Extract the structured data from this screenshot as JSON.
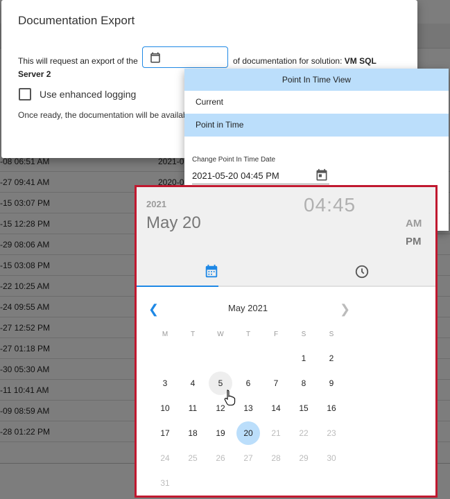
{
  "background": {
    "rows": [
      {
        "c1": "-08 06:51 AM",
        "c2": "2021-0"
      },
      {
        "c1": "-27 09:41 AM",
        "c2": "2020-0"
      },
      {
        "c1": "-15 03:07 PM",
        "c2": ""
      },
      {
        "c1": "-15 12:28 PM",
        "c2": ""
      },
      {
        "c1": "-29 08:06 AM",
        "c2": ""
      },
      {
        "c1": "-15 03:08 PM",
        "c2": ""
      },
      {
        "c1": "-22 10:25 AM",
        "c2": ""
      },
      {
        "c1": "-24 09:55 AM",
        "c2": ""
      },
      {
        "c1": "-27 12:52 PM",
        "c2": ""
      },
      {
        "c1": "-27 01:18 PM",
        "c2": ""
      },
      {
        "c1": "-30 05:30 AM",
        "c2": ""
      },
      {
        "c1": "-11 10:41 AM",
        "c2": ""
      },
      {
        "c1": "-09 08:59 AM",
        "c2": ""
      },
      {
        "c1": "-28 01:22 PM",
        "c2": ""
      }
    ]
  },
  "dialog": {
    "title": "Documentation Export",
    "text_before": "This will request an export of the",
    "text_after": "of documentation for solution:",
    "solution_part1": "VM SQL",
    "solution_part2": "Server 2",
    "checkbox_label": "Use enhanced logging",
    "ready_text": "Once ready, the documentation will be availab",
    "date_input_value": ""
  },
  "point_in_time": {
    "header": "Point In Time View",
    "options": [
      "Current",
      "Point in Time"
    ],
    "selected_index": 1,
    "date_label": "Change Point In Time Date",
    "date_value": "2021-05-20 04:45 PM"
  },
  "picker": {
    "year": "2021",
    "date": "May 20",
    "hours": "04",
    "minutes": "45",
    "am": "AM",
    "pm": "PM",
    "month_label": "May 2021",
    "weekdays": [
      "M",
      "T",
      "W",
      "T",
      "F",
      "S",
      "S"
    ],
    "weeks": [
      [
        "",
        "",
        "",
        "",
        "",
        "1",
        "2"
      ],
      [
        "3",
        "4",
        "5",
        "6",
        "7",
        "8",
        "9"
      ],
      [
        "10",
        "11",
        "12",
        "13",
        "14",
        "15",
        "16"
      ],
      [
        "17",
        "18",
        "19",
        "20",
        "21",
        "22",
        "23"
      ],
      [
        "24",
        "25",
        "26",
        "27",
        "28",
        "29",
        "30"
      ],
      [
        "31",
        "",
        "",
        "",
        "",
        "",
        ""
      ]
    ],
    "selected_day": "20",
    "hovered_day": "5",
    "last_enabled_day": "20"
  },
  "colors": {
    "accent": "#1e88e5",
    "selected_bg": "#bbdefb",
    "highlight_border": "#c0182f"
  }
}
